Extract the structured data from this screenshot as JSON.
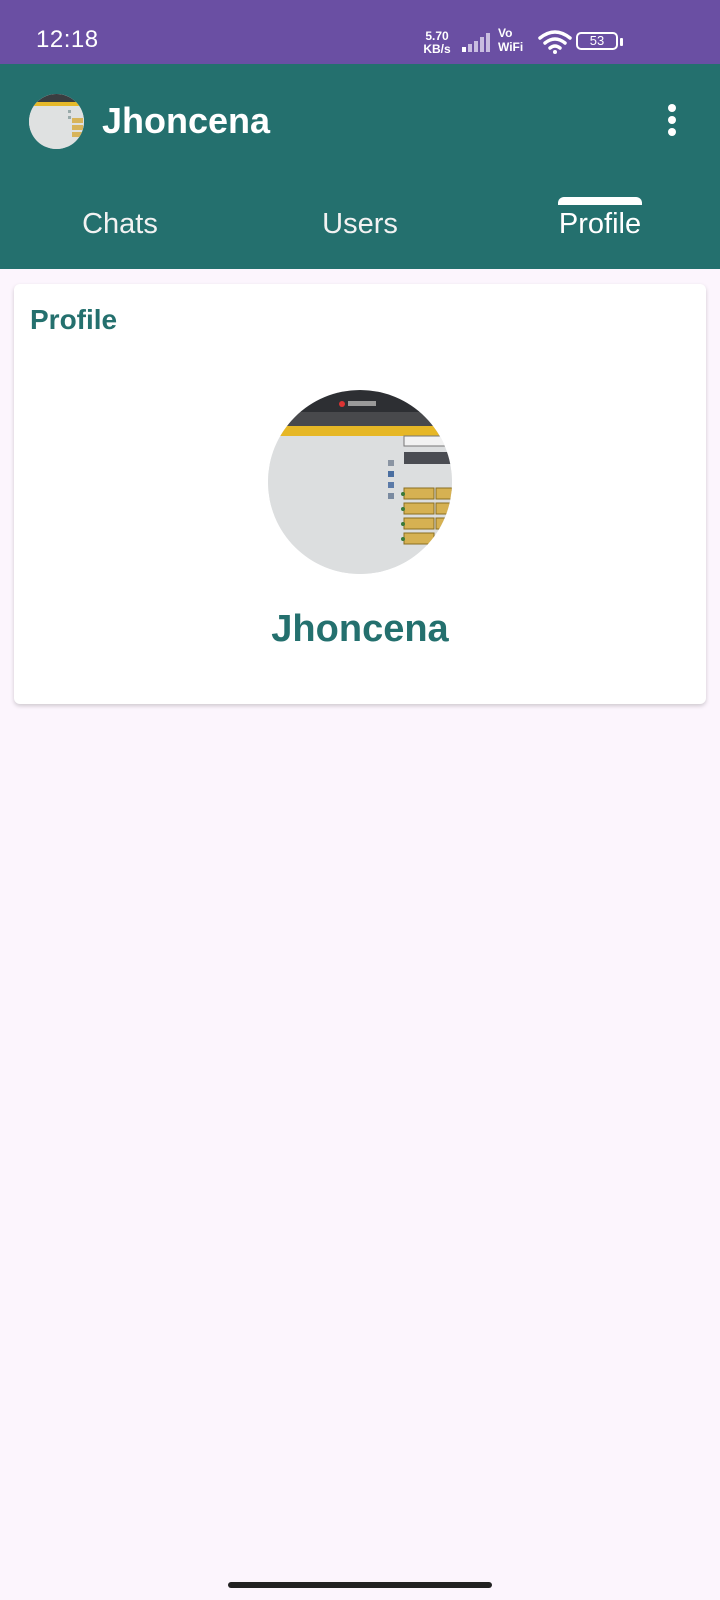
{
  "status_bar": {
    "time": "12:18",
    "net_speed_value": "5.70",
    "net_speed_unit": "KB/s",
    "vowifi_top": "Vo",
    "vowifi_bottom": "WiFi",
    "battery": "53",
    "icons": [
      "signal-icon",
      "wifi-icon",
      "battery-icon"
    ]
  },
  "app_bar": {
    "title": "Jhoncena",
    "menu_icon": "more-vert-icon",
    "color": "#24706e"
  },
  "tabs": [
    {
      "label": "Chats",
      "active": false
    },
    {
      "label": "Users",
      "active": false
    },
    {
      "label": "Profile",
      "active": true
    }
  ],
  "profile_card": {
    "title": "Profile",
    "name": "Jhoncena",
    "avatar_icon": "profile-photo"
  },
  "colors": {
    "status_bar": "#6a4fa3",
    "accent": "#24706e",
    "background": "#fcf5fd"
  }
}
